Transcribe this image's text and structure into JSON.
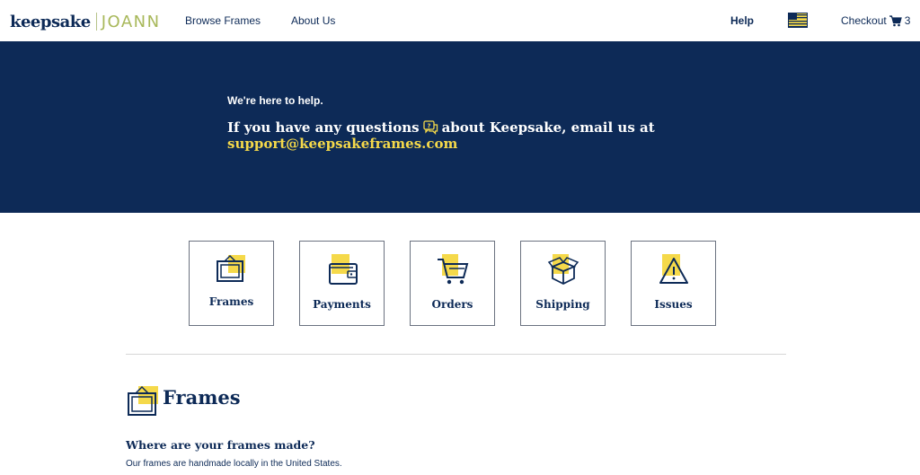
{
  "header": {
    "logo_primary": "keepsake",
    "logo_secondary": "JOANN",
    "nav": {
      "browse": "Browse Frames",
      "about": "About Us",
      "help": "Help"
    },
    "checkout_label": "Checkout",
    "cart_count": "3",
    "flag_icon": "us-flag-icon"
  },
  "hero": {
    "intro": "We're here to help.",
    "line_before": "If you have any questions",
    "line_after": "about Keepsake, email us at",
    "email": "support@keepsakeframes.com"
  },
  "categories": [
    {
      "label": "Frames",
      "icon": "frame-icon"
    },
    {
      "label": "Payments",
      "icon": "wallet-icon"
    },
    {
      "label": "Orders",
      "icon": "cart-icon"
    },
    {
      "label": "Shipping",
      "icon": "box-icon"
    },
    {
      "label": "Issues",
      "icon": "warning-icon"
    }
  ],
  "section": {
    "title": "Frames",
    "question": "Where are your frames made?",
    "answer": "Our frames are handmade locally in the United States."
  },
  "colors": {
    "navy": "#0d2a57",
    "yellow": "#f5d94a",
    "joann_green": "#a8b85a"
  }
}
